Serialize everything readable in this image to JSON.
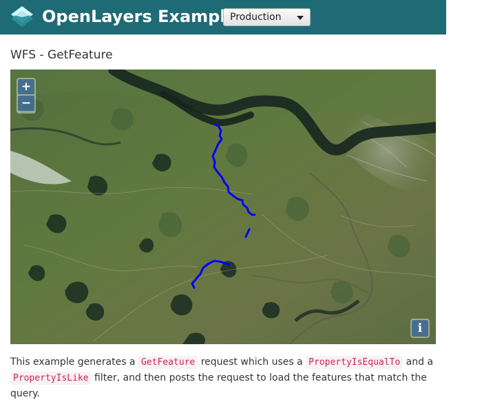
{
  "header": {
    "brand": "OpenLayers Examples",
    "version_select": {
      "selected": "Production"
    },
    "colors": {
      "bar": "#1f6b75",
      "logo_light": "#8ee3ef",
      "logo_dark": "#1f7a87"
    }
  },
  "page": {
    "title": "WFS - GetFeature"
  },
  "map": {
    "zoom_in_label": "+",
    "zoom_out_label": "−",
    "attribution_label": "i",
    "feature_color": "#0000ff"
  },
  "description": {
    "part1": "This example generates a ",
    "code1": "GetFeature",
    "part2": " request which uses a ",
    "code2": "PropertyIsEqualTo",
    "part3": " and a ",
    "code3": "PropertyIsLike",
    "part4": " filter, and then posts the request to load the features that match the query."
  }
}
